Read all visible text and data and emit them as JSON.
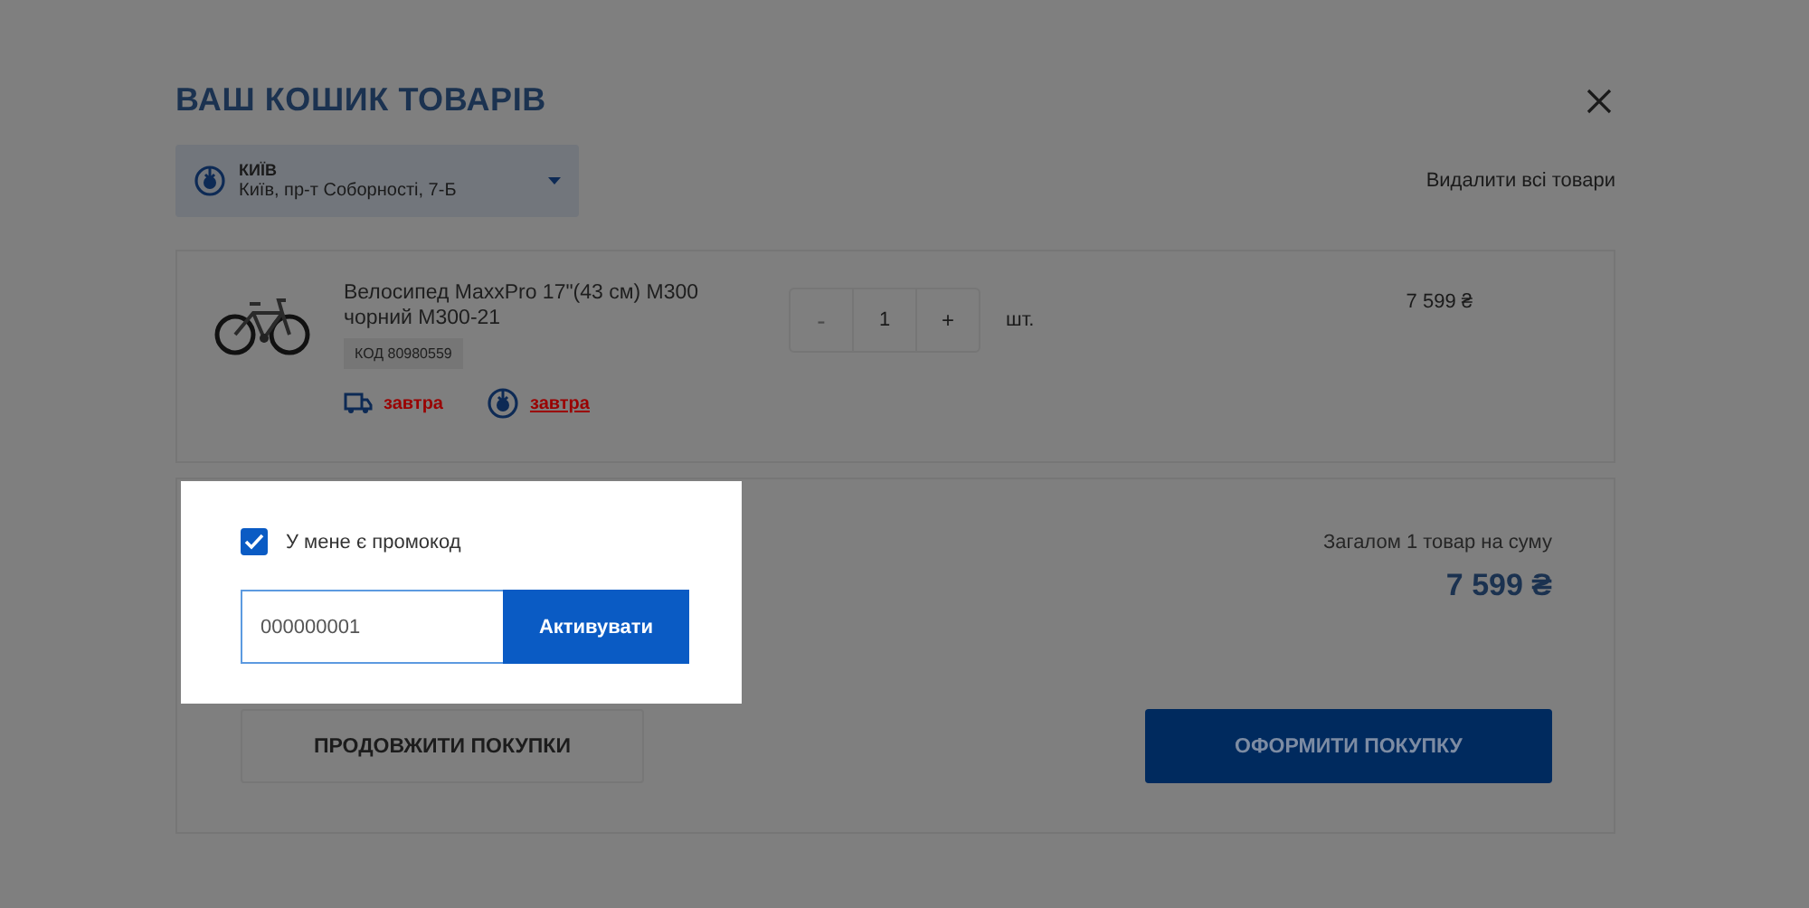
{
  "header": {
    "title": "ВАШ КОШИК ТОВАРІВ"
  },
  "store": {
    "city": "КИЇВ",
    "address": "Київ, пр-т Соборності, 7-Б"
  },
  "remove_all": "Видалити всі товари",
  "items": [
    {
      "kind": "picture",
      "name": "Велосипед MaxxPro 17\"(43 см) M300 чорний M300-21",
      "code": "КОД 80980559",
      "delivery": "завтра",
      "pickup": "завтра",
      "minus": "-",
      "minus_disabled": true,
      "quantity": "1",
      "plus": "+",
      "unit": "шт.",
      "price": "7 599 ₴"
    }
  ],
  "promo": {
    "checked": true,
    "label": "У мене є промокод",
    "value": "000000001",
    "button": "Активувати"
  },
  "summary": {
    "label": "Загалом 1 товар на суму",
    "total": "7 599 ₴"
  },
  "buttons": {
    "continue": "ПРОДОВЖИТИ ПОКУПКИ",
    "checkout": "ОФОРМИТИ ПОКУПКУ"
  }
}
